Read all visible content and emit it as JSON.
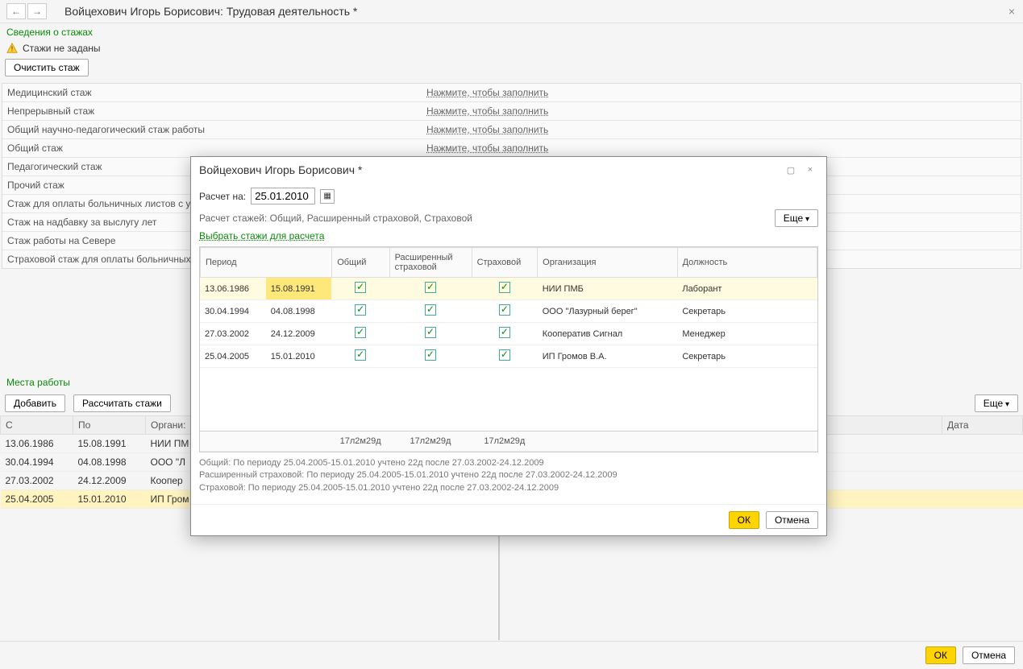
{
  "page_title": "Войцехович Игорь Борисович: Трудовая деятельность *",
  "section_staj": "Сведения о стажах",
  "warn_text": "Стажи не заданы",
  "btn_clear_staj": "Очистить стаж",
  "fill_link": "Нажмите, чтобы заполнить",
  "staj_rows": [
    {
      "label": "Медицинский стаж"
    },
    {
      "label": "Непрерывный стаж"
    },
    {
      "label": "Общий научно-педагогический стаж работы"
    },
    {
      "label": "Общий стаж"
    },
    {
      "label": "Педагогический стаж"
    },
    {
      "label": "Прочий стаж"
    },
    {
      "label": "Стаж для оплаты больничных листов с учето"
    },
    {
      "label": "Стаж на надбавку за выслугу лет"
    },
    {
      "label": "Стаж работы на Севере"
    },
    {
      "label": "Страховой стаж для оплаты больничных лис"
    }
  ],
  "section_workplace": "Места работы",
  "btn_add": "Добавить",
  "btn_calc": "Рассчитать стажи",
  "btn_more": "Еще",
  "bg_cols": {
    "c": "С",
    "po": "По",
    "org": "Органи:",
    "date": "Дата"
  },
  "bg_rows": [
    {
      "s": "13.06.1986",
      "e": "15.08.1991",
      "org": "НИИ ПМ"
    },
    {
      "s": "30.04.1994",
      "e": "04.08.1998",
      "org": "ООО \"Л"
    },
    {
      "s": "27.03.2002",
      "e": "24.12.2009",
      "org": "Коопер"
    },
    {
      "s": "25.04.2005",
      "e": "15.01.2010",
      "org": "ИП Гром"
    }
  ],
  "modal": {
    "title": "Войцехович Игорь Борисович *",
    "calc_on_label": "Расчет на:",
    "calc_on_value": "25.01.2010",
    "info_text": "Расчет стажей: Общий, Расширенный страховой, Страховой",
    "select_link": "Выбрать стажи для расчета",
    "cols": {
      "period": "Период",
      "general": "Общий",
      "ext_ins": "Расширенный страховой",
      "ins": "Страховой",
      "org": "Организация",
      "pos": "Должность"
    },
    "rows": [
      {
        "s": "13.06.1986",
        "e": "15.08.1991",
        "org": "НИИ ПМБ",
        "pos": "Лаборант"
      },
      {
        "s": "30.04.1994",
        "e": "04.08.1998",
        "org": "ООО \"Лазурный берег\"",
        "pos": "Секретарь"
      },
      {
        "s": "27.03.2002",
        "e": "24.12.2009",
        "org": "Кооператив Сигнал",
        "pos": "Менеджер"
      },
      {
        "s": "25.04.2005",
        "e": "15.01.2010",
        "org": "ИП Громов В.А.",
        "pos": "Секретарь"
      }
    ],
    "totals": {
      "general": "17л2м29д",
      "ext_ins": "17л2м29д",
      "ins": "17л2м29д"
    },
    "notes": [
      "Общий: По периоду 25.04.2005-15.01.2010 учтено 22д после 27.03.2002-24.12.2009",
      "Расширенный страховой: По периоду 25.04.2005-15.01.2010 учтено 22д после 27.03.2002-24.12.2009",
      "Страховой: По периоду 25.04.2005-15.01.2010 учтено 22д после 27.03.2002-24.12.2009"
    ],
    "btn_ok": "ОК",
    "btn_cancel": "Отмена"
  },
  "footer": {
    "ok": "ОК",
    "cancel": "Отмена"
  }
}
